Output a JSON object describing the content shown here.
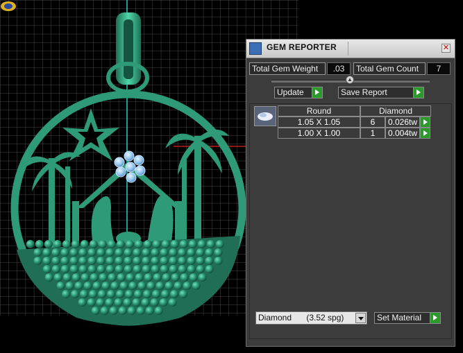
{
  "panel": {
    "title": "GEM REPORTER",
    "close_icon": "close-icon",
    "total_gem_weight_label": "Total Gem Weight",
    "total_gem_weight_value": ".03",
    "total_gem_count_label": "Total Gem Count",
    "total_gem_count_value": "7",
    "update_label": "Update",
    "save_report_label": "Save Report",
    "table": {
      "headers": [
        "Round",
        "Diamond"
      ],
      "rows": [
        {
          "size": "1.05 X 1.05",
          "count": "6",
          "weight": "0.026tw"
        },
        {
          "size": "1.00 X 1.00",
          "count": "1",
          "weight": "0.004tw"
        }
      ]
    },
    "material_select": {
      "value": "Diamond",
      "spg": "(3.52 spg)"
    },
    "set_material_label": "Set Material"
  },
  "colors": {
    "model": "#2e9a78",
    "model_dark": "#1f6e55",
    "gem": "#8fc3ee",
    "grid": "#4a4a4a",
    "accent_green": "#2a9a2a"
  }
}
